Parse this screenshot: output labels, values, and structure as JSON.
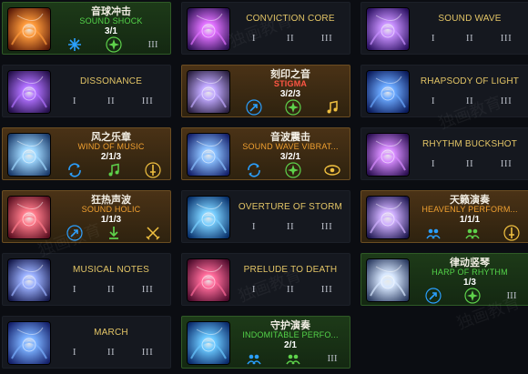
{
  "watermark": "独画教育",
  "skills": [
    {
      "id": "sound-shock",
      "cn": "音球冲击",
      "en": "SOUND SHOCK",
      "points": "3/1",
      "style": "green",
      "thumb": [
        "#ff9a3a",
        "#5a1a08"
      ],
      "runes": [
        {
          "k": "cross",
          "c": "#2a9fff"
        },
        {
          "k": "burst",
          "c": "#5ed24b"
        },
        {
          "k": "roman",
          "t": "III"
        }
      ]
    },
    {
      "id": "conviction-core",
      "en": "CONVICTION CORE",
      "style": "plain",
      "thumb": [
        "#e070ff",
        "#2a1050"
      ],
      "numerals": [
        "I",
        "II",
        "III"
      ]
    },
    {
      "id": "sound-wave",
      "en": "SOUND WAVE",
      "style": "plain",
      "thumb": [
        "#c890ff",
        "#2a1060"
      ],
      "numerals": [
        "I",
        "II",
        "III"
      ]
    },
    {
      "id": "dissonance",
      "en": "DISSONANCE",
      "style": "plain",
      "thumb": [
        "#b070ff",
        "#24104a"
      ],
      "numerals": [
        "I",
        "II",
        "III"
      ]
    },
    {
      "id": "stigma",
      "cn": "刻印之音",
      "en": "STIGMA",
      "points": "3/2/3",
      "style": "orange",
      "en_color": "red",
      "thumb": [
        "#c0a8ff",
        "#2a2040"
      ],
      "runes": [
        {
          "k": "arrow",
          "c": "#2a9fff"
        },
        {
          "k": "burst",
          "c": "#5ed24b"
        },
        {
          "k": "music",
          "c": "#f0c040"
        }
      ]
    },
    {
      "id": "rhapsody-of-light",
      "en": "RHAPSODY OF LIGHT",
      "style": "plain",
      "thumb": [
        "#6aa8ff",
        "#0a1a5a"
      ],
      "numerals": [
        "I",
        "II",
        "III"
      ]
    },
    {
      "id": "wind-of-music",
      "cn": "风之乐章",
      "en": "WIND OF MUSIC",
      "points": "2/1/3",
      "style": "orange",
      "thumb": [
        "#9fd8ff",
        "#1a3a6a"
      ],
      "runes": [
        {
          "k": "cycle",
          "c": "#2a9fff"
        },
        {
          "k": "music",
          "c": "#5ed24b"
        },
        {
          "k": "sword",
          "c": "#f0c040"
        }
      ]
    },
    {
      "id": "sound-wave-vibration",
      "cn": "音波震击",
      "en": "SOUND WAVE VIBRAT...",
      "points": "3/2/1",
      "style": "orange",
      "thumb": [
        "#8ac0ff",
        "#14206a"
      ],
      "runes": [
        {
          "k": "cycle",
          "c": "#2a9fff"
        },
        {
          "k": "burst",
          "c": "#5ed24b"
        },
        {
          "k": "eye",
          "c": "#f0c040"
        }
      ]
    },
    {
      "id": "rhythm-buckshot",
      "en": "RHYTHM BUCKSHOT",
      "style": "plain",
      "thumb": [
        "#d78cff",
        "#2a0f50"
      ],
      "numerals": [
        "I",
        "II",
        "III"
      ]
    },
    {
      "id": "sound-holic",
      "cn": "狂热声波",
      "en": "SOUND HOLIC",
      "points": "1/1/3",
      "style": "orange",
      "thumb": [
        "#ff7a8a",
        "#5a0f20"
      ],
      "runes": [
        {
          "k": "arrow",
          "c": "#2a9fff"
        },
        {
          "k": "down",
          "c": "#5ed24b"
        },
        {
          "k": "crossswords",
          "c": "#f0c040"
        }
      ]
    },
    {
      "id": "overture-of-storm",
      "en": "OVERTURE OF STORM",
      "style": "plain",
      "thumb": [
        "#7ad0ff",
        "#08306a"
      ],
      "numerals": [
        "I",
        "II",
        "III"
      ]
    },
    {
      "id": "heavenly-performance",
      "cn": "天籁演奏",
      "en": "HEAVENLY PERFORM...",
      "points": "1/1/1",
      "style": "orange",
      "thumb": [
        "#d0b0ff",
        "#1e1850"
      ],
      "runes": [
        {
          "k": "group",
          "c": "#2a9fff"
        },
        {
          "k": "group",
          "c": "#5ed24b"
        },
        {
          "k": "sword",
          "c": "#f0c040"
        }
      ]
    },
    {
      "id": "musical-notes",
      "en": "MUSICAL NOTES",
      "style": "plain",
      "thumb": [
        "#9ab0ff",
        "#14184a"
      ],
      "numerals": [
        "I",
        "II",
        "III"
      ]
    },
    {
      "id": "prelude-to-death",
      "en": "PRELUDE TO DEATH",
      "style": "plain",
      "thumb": [
        "#ff6a9a",
        "#4a0a2a"
      ],
      "numerals": [
        "I",
        "II",
        "III"
      ]
    },
    {
      "id": "harp-of-rhythm",
      "cn": "律动竖琴",
      "en": "HARP OF RHYTHM",
      "points": "1/3",
      "style": "green",
      "en_color": "green",
      "thumb": [
        "#d8e8ff",
        "#2a3a60"
      ],
      "runes": [
        {
          "k": "arrow",
          "c": "#2a9fff"
        },
        {
          "k": "burst",
          "c": "#5ed24b"
        },
        {
          "k": "roman",
          "t": "III"
        }
      ]
    },
    {
      "id": "march",
      "en": "MARCH",
      "style": "plain",
      "thumb": [
        "#7ab0ff",
        "#14206a"
      ],
      "numerals": [
        "I",
        "II",
        "III"
      ]
    },
    {
      "id": "indomitable-performance",
      "cn": "守护演奏",
      "en": "INDOMITABLE PERFO...",
      "points": "2/1",
      "style": "green",
      "en_color": "green",
      "thumb": [
        "#6ac8ff",
        "#0a2a6a"
      ],
      "runes": [
        {
          "k": "group",
          "c": "#2a9fff"
        },
        {
          "k": "group",
          "c": "#5ed24b"
        },
        {
          "k": "roman",
          "t": "III"
        }
      ]
    }
  ]
}
